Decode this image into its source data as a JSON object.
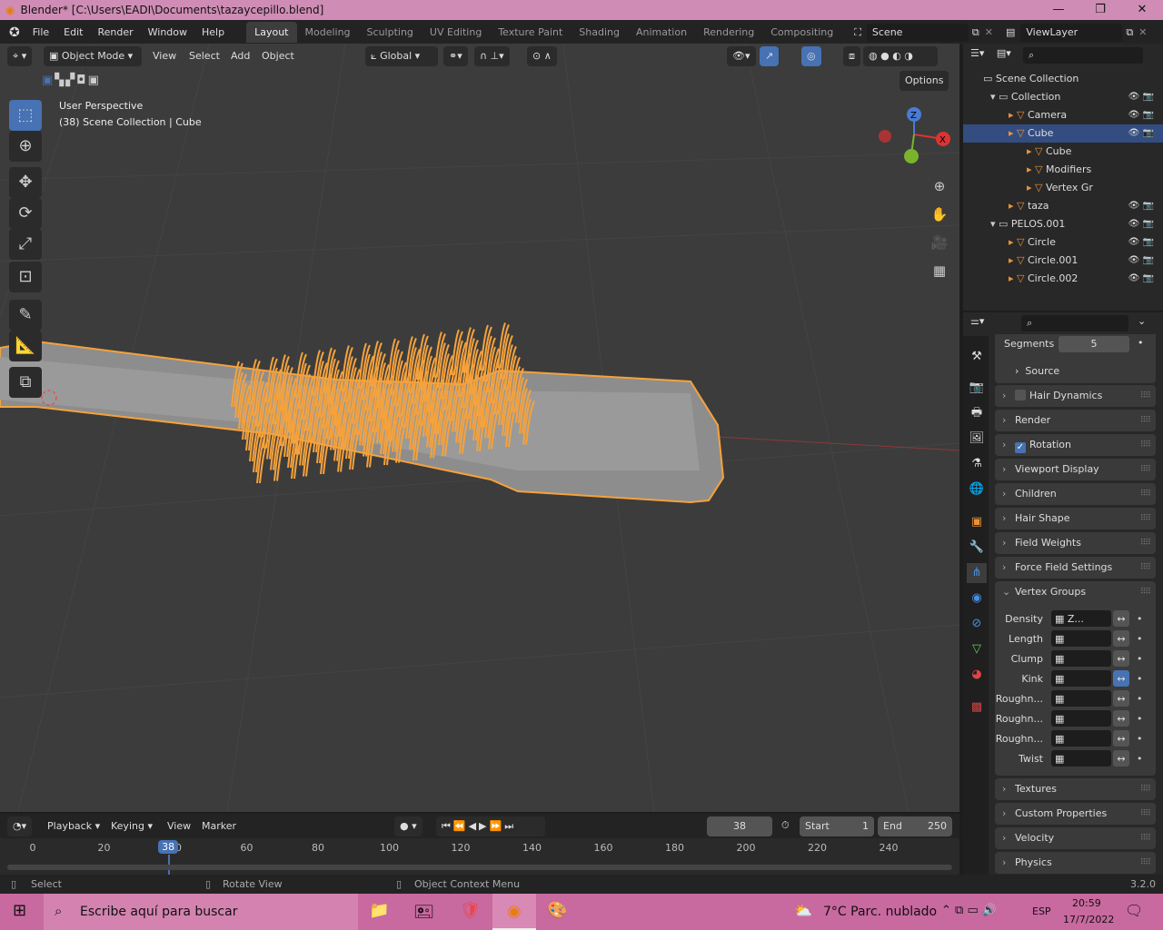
{
  "window": {
    "title": "Blender* [C:\\Users\\EADI\\Documents\\tazaycepillo.blend]",
    "minimize": "—",
    "maximize": "❐",
    "close": "✕"
  },
  "menus": [
    "File",
    "Edit",
    "Render",
    "Window",
    "Help"
  ],
  "workspaces": [
    "Layout",
    "Modeling",
    "Sculpting",
    "UV Editing",
    "Texture Paint",
    "Shading",
    "Animation",
    "Rendering",
    "Compositing"
  ],
  "active_workspace": "Layout",
  "scene": "Scene",
  "view_layer": "ViewLayer",
  "viewport": {
    "mode": "Object Mode",
    "menus": [
      "View",
      "Select",
      "Add",
      "Object"
    ],
    "orientation": "Global",
    "options": "Options",
    "perspective": "User Perspective",
    "context": "(38) Scene Collection | Cube",
    "gizmo": {
      "x": "X",
      "y": "Y",
      "z": "Z"
    }
  },
  "outliner": {
    "root": "Scene Collection",
    "rows": [
      {
        "label": "Collection",
        "depth": 1
      },
      {
        "label": "Camera",
        "depth": 2
      },
      {
        "label": "Cube",
        "depth": 2,
        "selected": true
      },
      {
        "label": "Cube",
        "depth": 3
      },
      {
        "label": "Modifiers",
        "depth": 3
      },
      {
        "label": "Vertex Gr",
        "depth": 3
      },
      {
        "label": "taza",
        "depth": 2
      },
      {
        "label": "PELOS.001",
        "depth": 1
      },
      {
        "label": "Circle",
        "depth": 2
      },
      {
        "label": "Circle.001",
        "depth": 2
      },
      {
        "label": "Circle.002",
        "depth": 2
      }
    ]
  },
  "properties": {
    "segments_label": "Segments",
    "segments_value": "5",
    "source": "Source",
    "panels": [
      {
        "label": "Hair Dynamics",
        "checkbox": false
      },
      {
        "label": "Render"
      },
      {
        "label": "Rotation",
        "checkbox": true
      },
      {
        "label": "Viewport Display"
      },
      {
        "label": "Children"
      },
      {
        "label": "Hair Shape"
      },
      {
        "label": "Field Weights"
      },
      {
        "label": "Force Field Settings"
      }
    ],
    "vertex_groups": {
      "label": "Vertex Groups",
      "rows": [
        {
          "label": "Density",
          "value": "Z...",
          "invert": false
        },
        {
          "label": "Length",
          "value": "",
          "invert": false
        },
        {
          "label": "Clump",
          "value": "",
          "invert": false
        },
        {
          "label": "Kink",
          "value": "",
          "invert": true
        },
        {
          "label": "Roughn...",
          "value": "",
          "invert": false
        },
        {
          "label": "Roughn...",
          "value": "",
          "invert": false
        },
        {
          "label": "Roughn...",
          "value": "",
          "invert": false
        },
        {
          "label": "Twist",
          "value": "",
          "invert": false
        }
      ]
    },
    "panels_after": [
      "Textures",
      "Custom Properties",
      "Velocity",
      "Physics"
    ]
  },
  "timeline": {
    "menus": [
      "Playback",
      "Keying",
      "View",
      "Marker"
    ],
    "current_frame": "38",
    "start_label": "Start",
    "start": "1",
    "end_label": "End",
    "end": "250",
    "ticks": [
      "0",
      "20",
      "40",
      "60",
      "80",
      "100",
      "120",
      "140",
      "160",
      "180",
      "200",
      "220",
      "240"
    ]
  },
  "status": {
    "select": "Select",
    "rotate": "Rotate View",
    "context_menu": "Object Context Menu",
    "version": "3.2.0"
  },
  "taskbar": {
    "search_placeholder": "Escribe aquí para buscar",
    "weather": "7°C  Parc. nublado",
    "lang": "ESP",
    "time": "20:59",
    "date": "17/7/2022"
  },
  "colors": {
    "accent": "#4772b3",
    "selection": "#f5a23c",
    "titlebar": "#cf8db5",
    "taskbar": "#c8699f"
  }
}
